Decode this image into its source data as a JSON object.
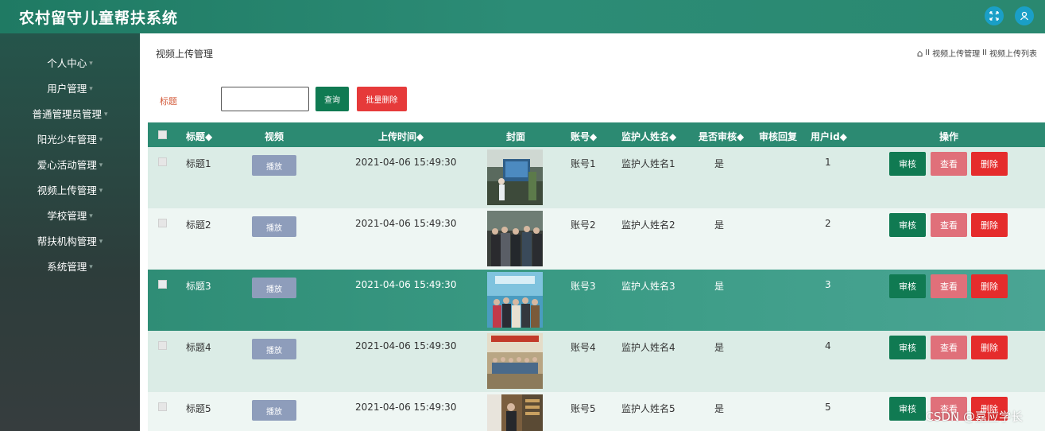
{
  "header": {
    "title": "农村留守儿童帮扶系统"
  },
  "sidebar": {
    "items": [
      {
        "label": "个人中心"
      },
      {
        "label": "用户管理"
      },
      {
        "label": "普通管理员管理"
      },
      {
        "label": "阳光少年管理"
      },
      {
        "label": "爱心活动管理"
      },
      {
        "label": "视频上传管理"
      },
      {
        "label": "学校管理"
      },
      {
        "label": "帮扶机构管理"
      },
      {
        "label": "系统管理"
      }
    ]
  },
  "main": {
    "page_title": "视频上传管理",
    "breadcrumb": [
      "视频上传管理",
      "视频上传列表"
    ],
    "breadcrumb_sep": "II",
    "search": {
      "label": "标题",
      "value": "",
      "placeholder": ""
    },
    "query_label": "查询",
    "batch_delete_label": "批量删除"
  },
  "table": {
    "columns": [
      "标题◆",
      "视频",
      "上传时间◆",
      "封面",
      "账号◆",
      "监护人姓名◆",
      "是否审核◆",
      "审核回复",
      "用户id◆",
      "操作"
    ],
    "rows": [
      {
        "title": "标题1",
        "play": "播放",
        "time": "2021-04-06 15:49:30",
        "account": "账号1",
        "guardian": "监护人姓名1",
        "audited": "是",
        "reply": "",
        "userid": "1"
      },
      {
        "title": "标题2",
        "play": "播放",
        "time": "2021-04-06 15:49:30",
        "account": "账号2",
        "guardian": "监护人姓名2",
        "audited": "是",
        "reply": "",
        "userid": "2"
      },
      {
        "title": "标题3",
        "play": "播放",
        "time": "2021-04-06 15:49:30",
        "account": "账号3",
        "guardian": "监护人姓名3",
        "audited": "是",
        "reply": "",
        "userid": "3"
      },
      {
        "title": "标题4",
        "play": "播放",
        "time": "2021-04-06 15:49:30",
        "account": "账号4",
        "guardian": "监护人姓名4",
        "audited": "是",
        "reply": "",
        "userid": "4"
      },
      {
        "title": "标题5",
        "play": "播放",
        "time": "2021-04-06 15:49:30",
        "account": "账号5",
        "guardian": "监护人姓名5",
        "audited": "是",
        "reply": "",
        "userid": "5"
      }
    ],
    "actions": {
      "audit": "审核",
      "view": "查看",
      "delete": "删除"
    }
  },
  "watermark": "CSDN @嘉应学长",
  "colors": {
    "header": "#2c8c76",
    "query": "#107a52",
    "danger": "#e63a3a",
    "view": "#e0707a",
    "play": "#8e9dbb"
  }
}
